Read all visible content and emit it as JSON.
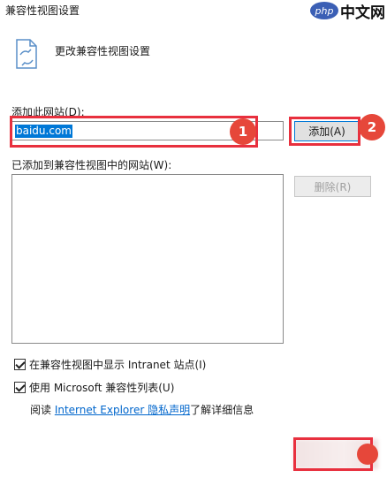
{
  "window": {
    "title": "兼容性视图设置"
  },
  "watermark": {
    "badge": "php",
    "text": "中文网"
  },
  "header": {
    "icon": "document-sync-icon",
    "text": "更改兼容性视图设置"
  },
  "add_site": {
    "label": "添加此网站(D):",
    "value": "baidu.com",
    "add_button": "添加(A)"
  },
  "added_sites": {
    "label": "已添加到兼容性视图中的网站(W):",
    "items": [],
    "remove_button": "删除(R)"
  },
  "options": {
    "intranet": {
      "label": "在兼容性视图中显示 Intranet 站点(I)",
      "checked": true
    },
    "ms_list": {
      "label": "使用 Microsoft 兼容性列表(U)",
      "checked": true
    }
  },
  "privacy": {
    "prefix": "阅读 ",
    "link": "Internet Explorer 隐私声明",
    "suffix": "了解详细信息"
  },
  "annotations": {
    "step1": "1",
    "step2": "2"
  },
  "colors": {
    "annotation": "#e8303e",
    "selection": "#0078d7",
    "link": "#0066cc"
  }
}
